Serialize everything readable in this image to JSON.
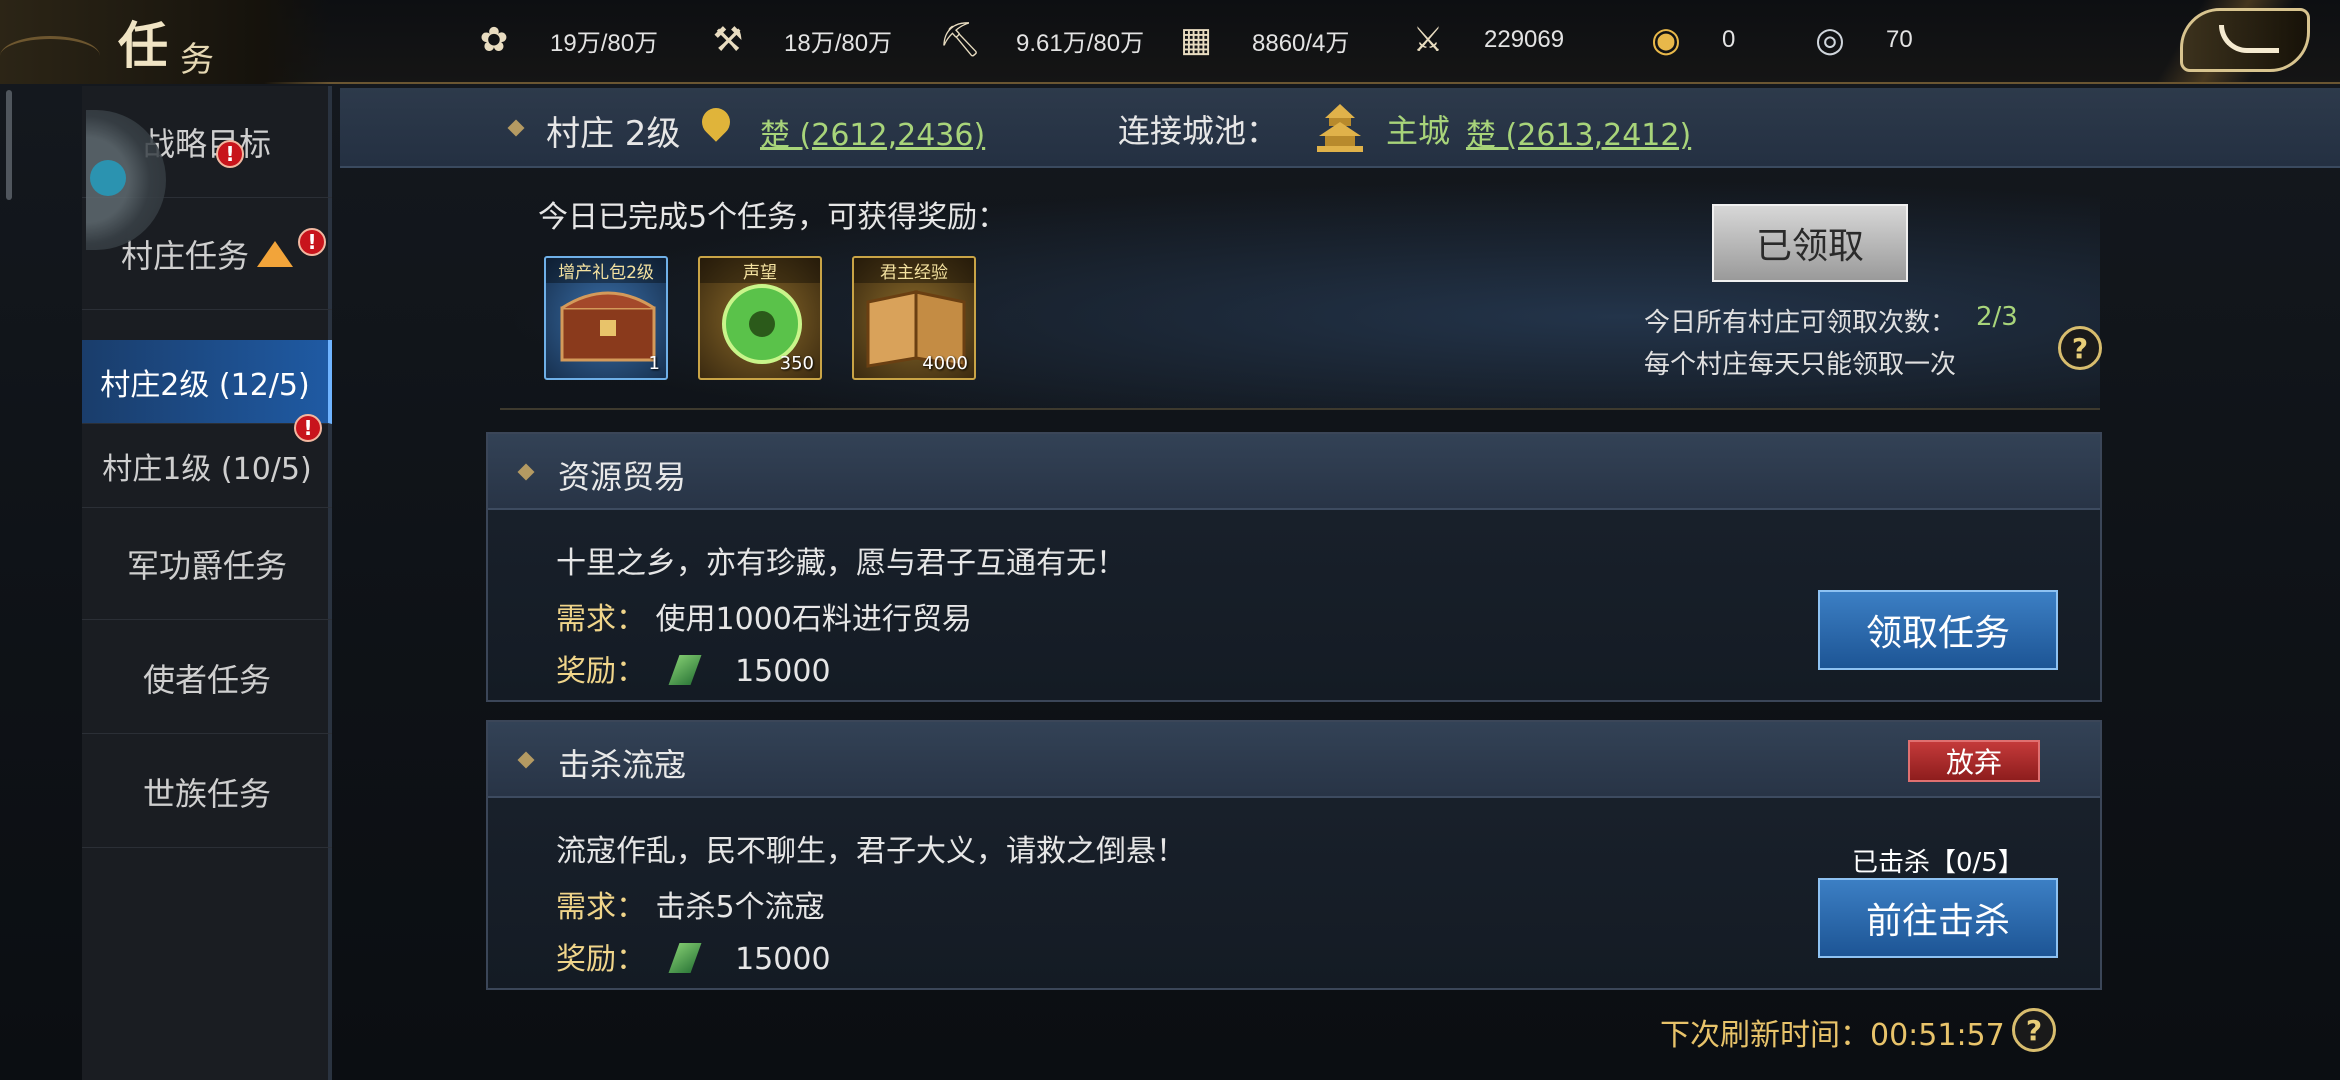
{
  "title": {
    "main": "任",
    "sub": "务"
  },
  "resources": [
    {
      "icon": "grain-icon",
      "glyph": "✿",
      "value": "19万/80万"
    },
    {
      "icon": "wood-icon",
      "glyph": "⚒",
      "value": "18万/80万"
    },
    {
      "icon": "iron-icon",
      "glyph": "⛏",
      "value": "9.61万/80万"
    },
    {
      "icon": "stone-icon",
      "glyph": "▦",
      "value": "8860/4万"
    },
    {
      "icon": "copper-icon",
      "glyph": "⚔",
      "value": "229069"
    },
    {
      "icon": "gold-ingot-icon",
      "glyph": "◉",
      "value": "0"
    },
    {
      "icon": "silver-ingot-icon",
      "glyph": "◎",
      "value": "70"
    }
  ],
  "sidebar": {
    "items": [
      {
        "label": "战略目标"
      },
      {
        "label": "村庄任务"
      },
      {
        "label": "村庄2级 (12/5)"
      },
      {
        "label": "村庄1级 (10/5)"
      },
      {
        "label": "军功爵任务"
      },
      {
        "label": "使者任务"
      },
      {
        "label": "世族任务"
      }
    ]
  },
  "header": {
    "village": "村庄 2级",
    "village_coord": "楚 (2612,2436)",
    "connect_label": "连接城池：",
    "city": "主城",
    "city_coord": "楚 (2613,2412)"
  },
  "reward": {
    "intro": "今日已完成5个任务，可获得奖励：",
    "items": [
      {
        "label": "增产礼包2级",
        "count": "1"
      },
      {
        "label": "声望",
        "count": "350"
      },
      {
        "label": "君主经验",
        "count": "4000"
      }
    ],
    "claimed_button": "已领取",
    "times_label": "今日所有村庄可领取次数：",
    "times_value": "2/3",
    "note": "每个村庄每天只能领取一次"
  },
  "quests": [
    {
      "title": "资源贸易",
      "desc": "十里之乡，亦有珍藏，愿与君子互通有无！",
      "req_label": "需求：",
      "req": "使用1000石料进行贸易",
      "reward_label": "奖励：",
      "reward": "15000",
      "button": "领取任务"
    },
    {
      "title": "击杀流寇",
      "desc": "流寇作乱，民不聊生，君子大义，请救之倒悬！",
      "req_label": "需求：",
      "req": "击杀5个流寇",
      "reward_label": "奖励：",
      "reward": "15000",
      "progress": "已击杀【0/5】",
      "abandon": "放弃",
      "button": "前往击杀"
    }
  ],
  "footer": {
    "refresh": "下次刷新时间：00:51:57"
  },
  "colors": {
    "accent_green": "#a8d47a",
    "gold": "#e8c36a",
    "blue_button": "#2a6ab0",
    "red_button": "#b42a2a"
  }
}
